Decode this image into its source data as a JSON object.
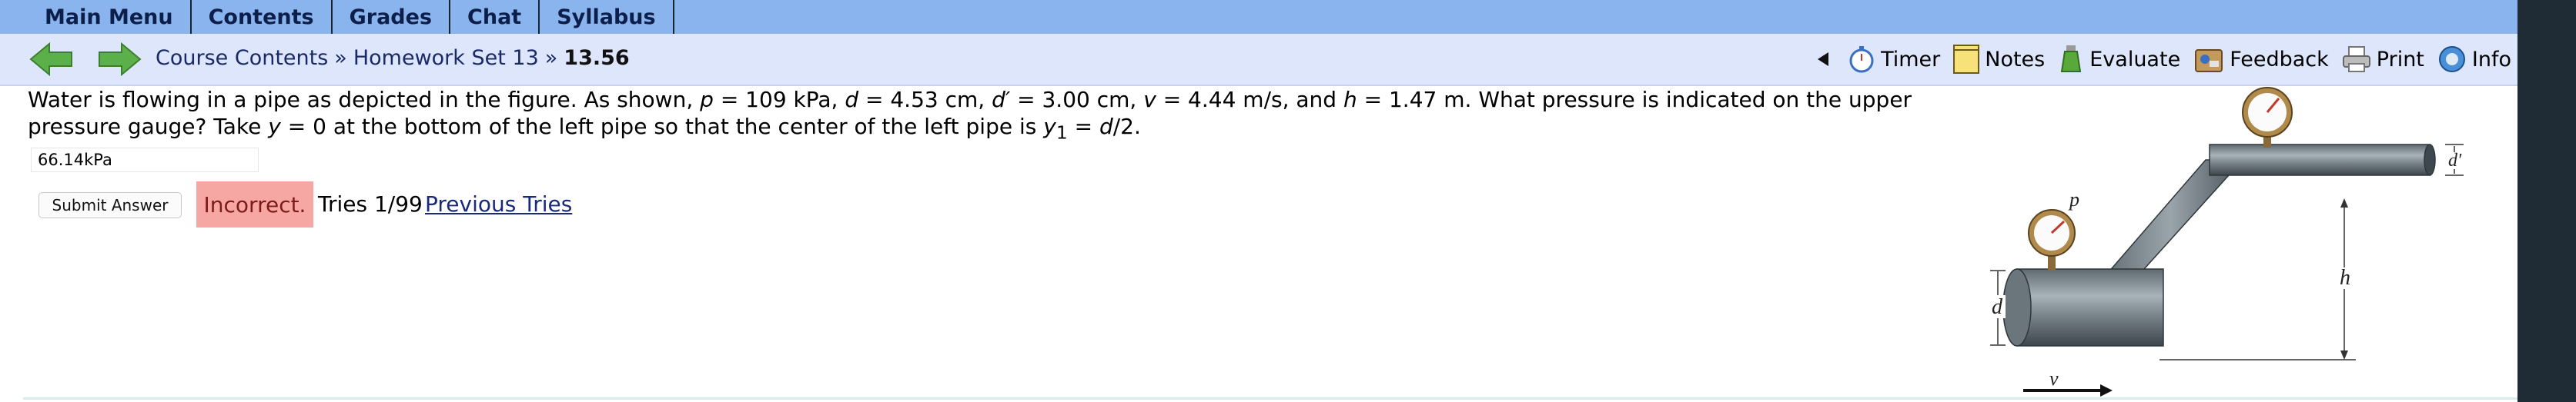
{
  "menu": {
    "items": [
      "Main Menu",
      "Contents",
      "Grades",
      "Chat",
      "Syllabus"
    ]
  },
  "nav": {
    "breadcrumb_course": "Course Contents",
    "breadcrumb_separator": "»",
    "breadcrumb_set": "Homework Set 13",
    "breadcrumb_current": "13.56",
    "tools": {
      "timer": "Timer",
      "notes": "Notes",
      "evaluate": "Evaluate",
      "feedback": "Feedback",
      "print": "Print",
      "info": "Info"
    }
  },
  "question": {
    "text_part1": "Water is flowing in a pipe as depicted in the figure. As shown, ",
    "p_var": "p",
    "p_val": " = 109 kPa, ",
    "d_var": "d",
    "d_val": " = 4.53 cm, ",
    "dp_var": "d′",
    "dp_val": " = 3.00 cm, ",
    "v_var": "v",
    "v_val": " = 4.44 m/s, and ",
    "h_var": "h",
    "h_val": " = 1.47 m. What pressure is indicated on the upper pressure gauge? Take ",
    "y_var": "y",
    "y_val": " = 0 at the bottom of the left pipe so that the center of the left pipe is ",
    "y1_var": "y",
    "y1_sub": "1",
    "y1_eq": " = ",
    "d2_var": "d",
    "d2_tail": "/2."
  },
  "answer": {
    "value": "66.14kPa"
  },
  "submit_label": "Submit Answer",
  "status": {
    "incorrect": "Incorrect.",
    "tries": "Tries 1/99",
    "previous": "Previous Tries"
  },
  "figure": {
    "label_p": "p",
    "label_d": "d",
    "label_dprime": "d′",
    "label_h": "h",
    "label_v": "v"
  },
  "colors": {
    "menu_bar": "#8ab4ee",
    "nav_bar": "#dde6fb",
    "incorrect_bg": "#f7a7a3",
    "arrow_green": "#5bb04a"
  }
}
